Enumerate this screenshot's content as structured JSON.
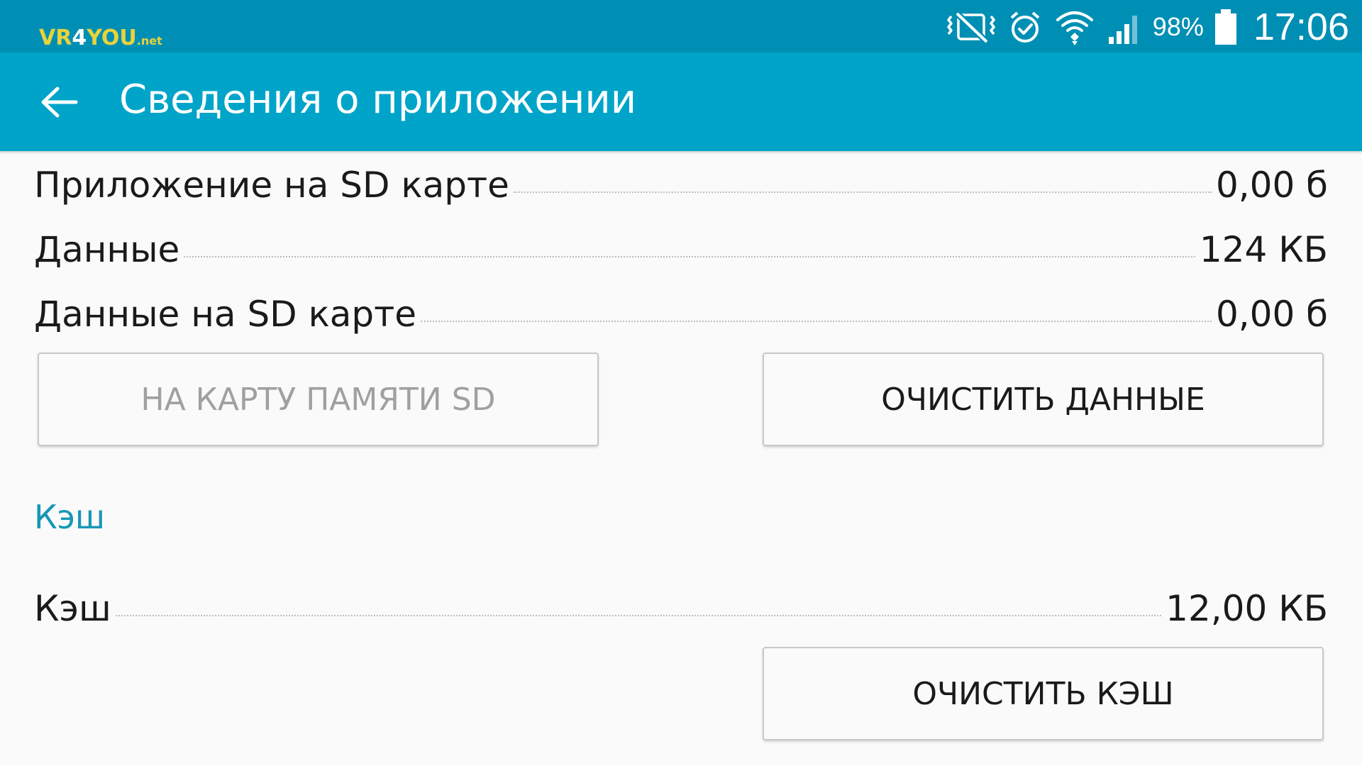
{
  "watermark": {
    "part1": "VR",
    "part2": "4",
    "part3": "YOU",
    "part4": ".net"
  },
  "status_bar": {
    "icons": [
      "vibrate-icon",
      "alarm-icon",
      "wifi-icon",
      "signal-icon",
      "battery-icon"
    ],
    "battery_percent": "98%",
    "time": "17:06"
  },
  "app_bar": {
    "back_icon": "arrow-back-icon",
    "title": "Сведения о приложении"
  },
  "storage": {
    "rows": [
      {
        "label": "Приложение на SD карте",
        "value": "0,00 б"
      },
      {
        "label": "Данные",
        "value": "124 КБ"
      },
      {
        "label": "Данные на SD карте",
        "value": "0,00 б"
      }
    ],
    "move_to_sd_button": "НА КАРТУ ПАМЯТИ SD",
    "clear_data_button": "ОЧИСТИТЬ ДАННЫЕ"
  },
  "cache": {
    "section_title": "Кэш",
    "label": "Кэш",
    "value": "12,00 КБ",
    "clear_cache_button": "ОЧИСТИТЬ КЭШ"
  },
  "colors": {
    "status_bar": "#008fb4",
    "app_bar": "#00a4c9",
    "accent": "#1797b5",
    "background": "#fafafa"
  }
}
